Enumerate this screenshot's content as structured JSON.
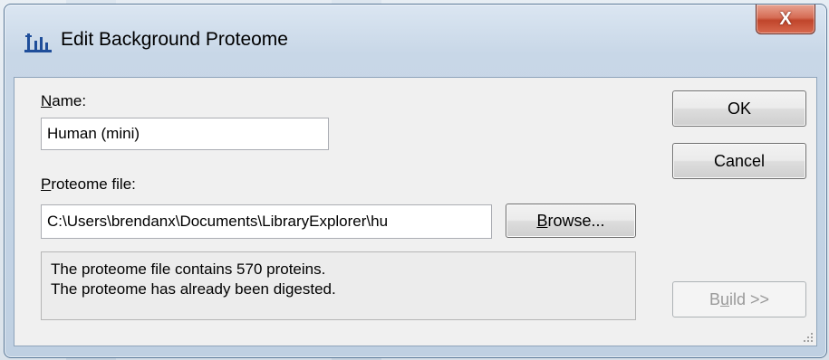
{
  "window": {
    "title": "Edit Background Proteome",
    "close_label": "X",
    "icon": "skyline-chart-icon"
  },
  "form": {
    "name_label_accel": "N",
    "name_label_rest": "ame:",
    "name_value": "Human (mini)",
    "proteome_label_accel": "P",
    "proteome_label_rest": "roteome file:",
    "proteome_value": "C:\\Users\\brendanx\\Documents\\LibraryExplorer\\hu",
    "browse_accel": "B",
    "browse_rest": "rowse...",
    "status_line1": "The proteome file contains 570 proteins.",
    "status_line2": "The proteome has already been digested."
  },
  "buttons": {
    "ok": "OK",
    "cancel": "Cancel",
    "build_pre": "B",
    "build_accel": "u",
    "build_rest": "ild >>"
  },
  "colors": {
    "close_button": "#c0452b",
    "client_bg": "#f0f0f0",
    "frame": "#bfd0e2"
  }
}
